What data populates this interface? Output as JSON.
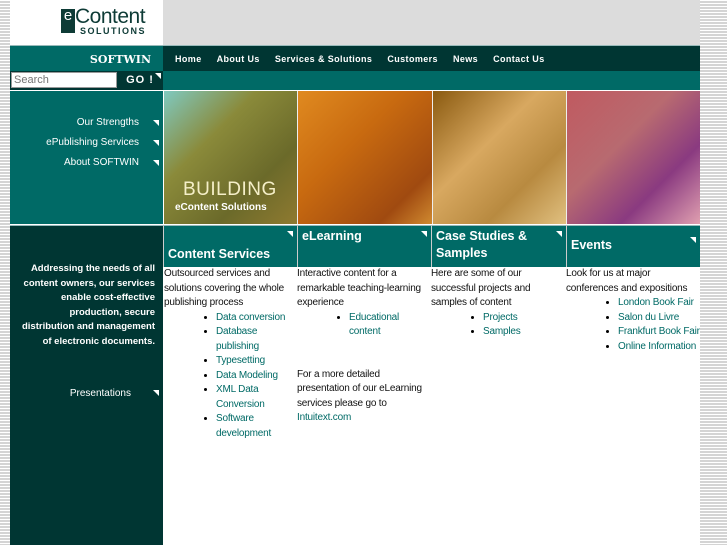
{
  "logo": {
    "mark": "e",
    "line1": "Content",
    "line2": "SOLUTIONS"
  },
  "brand": "SOFTWIN",
  "nav": [
    "Home",
    "About Us",
    "Services & Solutions",
    "Customers",
    "News",
    "Contact Us"
  ],
  "search": {
    "placeholder": "Search",
    "go": "GO !"
  },
  "leftmenu": [
    "Our Strengths",
    "ePublishing Services",
    "About SOFTWIN"
  ],
  "hero": {
    "line1": "BUILDING",
    "line2": "eContent Solutions"
  },
  "sidebar": {
    "text": "Addressing the needs of all content owners, our services enable cost-effective production, secure distribution and management of electronic documents.",
    "link": "Presentations"
  },
  "columns": [
    {
      "title": "Content Services",
      "intro": "Outsourced services and solutions covering the whole publishing process",
      "items": [
        "Data conversion",
        "Database publishing",
        "Typesetting",
        "Data Modeling",
        "XML Data Conversion",
        "Software development"
      ]
    },
    {
      "title": "eLearning",
      "intro": "Interactive content for a remarkable teaching-learning experience",
      "items": [
        "Educational content"
      ],
      "extra": "For a more detailed presentation of our eLearning services please go to",
      "link": "Intuitext.com"
    },
    {
      "title": "Case Studies & Samples",
      "intro": "Here are some of our successful projects and samples of content",
      "items": [
        "Projects",
        "Samples"
      ]
    },
    {
      "title": "Events",
      "intro": "Look for us at major conferences and expositions",
      "items": [
        "London Book Fair",
        "Salon du Livre",
        "Frankfurt Book Fair",
        "Online Information"
      ]
    }
  ]
}
